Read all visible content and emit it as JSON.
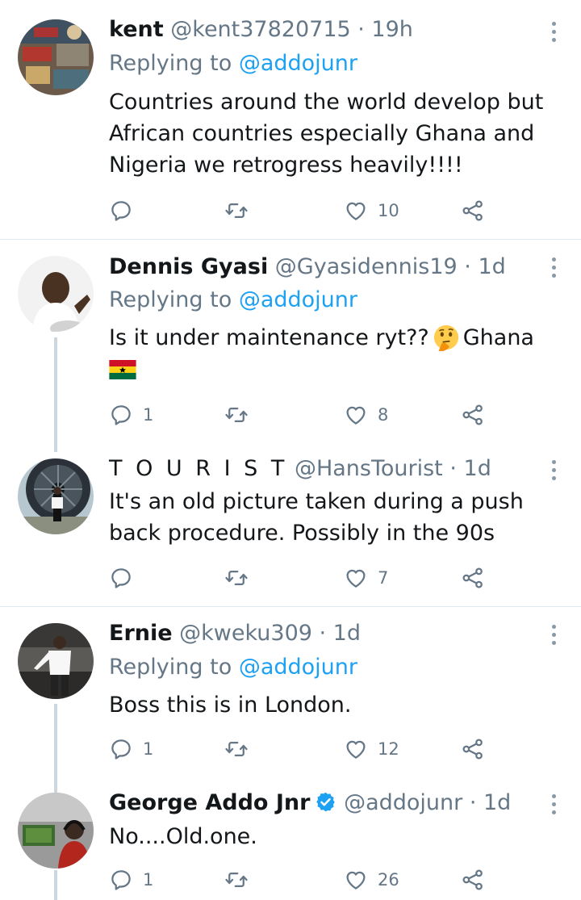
{
  "tweets": [
    {
      "name": "kent",
      "handle": "@kent37820715 · 19h",
      "replying_prefix": "Replying to ",
      "replying_to": "@addojunr",
      "text": "Countries around the world develop but African countries especially Ghana and Nigeria we retrogress heavily!!!!",
      "reply_count": "",
      "retweet_count": "",
      "like_count": "10"
    },
    {
      "name": "Dennis Gyasi",
      "handle": "@Gyasidennis19 · 1d",
      "replying_prefix": "Replying to ",
      "replying_to": "@addojunr",
      "text_before": "Is it under maintenance ryt??",
      "text_after": "Ghana",
      "reply_count": "1",
      "retweet_count": "",
      "like_count": "8"
    },
    {
      "name": "T O U R I S T",
      "handle": "@HansTourist · 1d",
      "text": "It's an old picture taken during a push back procedure. Possibly in the 90s",
      "reply_count": "",
      "retweet_count": "",
      "like_count": "7"
    },
    {
      "name": "Ernie",
      "handle": "@kweku309 · 1d",
      "replying_prefix": "Replying to ",
      "replying_to": "@addojunr",
      "text": "Boss this is in London.",
      "reply_count": "1",
      "retweet_count": "",
      "like_count": "12"
    },
    {
      "name": "George Addo Jnr",
      "handle": "@addojunr · 1d",
      "text": "No....Old.one.",
      "reply_count": "1",
      "retweet_count": "",
      "like_count": "26"
    }
  ],
  "icons": {
    "reply": "reply-icon",
    "retweet": "retweet-icon",
    "like": "heart-icon",
    "share": "share-icon",
    "more": "more-vertical-icon",
    "verified": "verified-badge-icon"
  },
  "colors": {
    "accent": "#1da1f2",
    "secondary_text": "#657786",
    "icon_gray": "#657786",
    "divider": "#e1e8ed",
    "thread_line": "#ccd6dd"
  }
}
